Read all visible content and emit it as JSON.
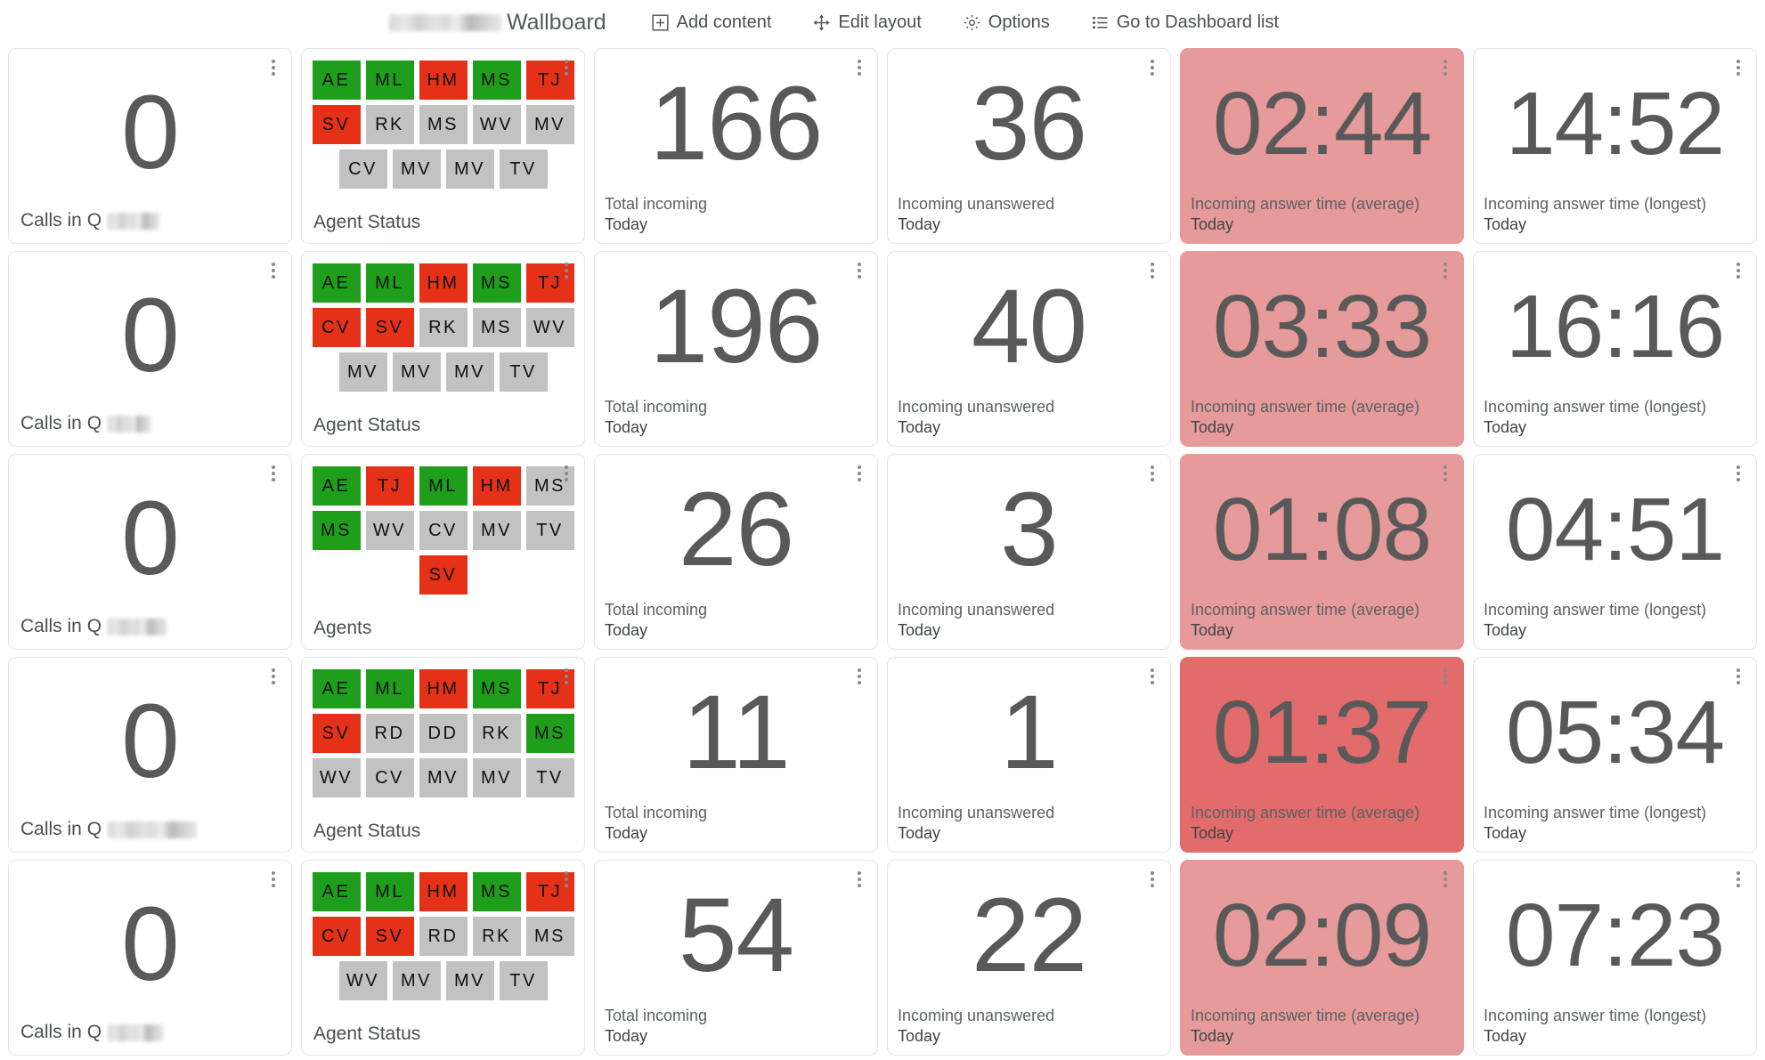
{
  "toolbar": {
    "title_suffix": "Wallboard",
    "title_redacted": true,
    "items": [
      {
        "label": "Add content",
        "icon": "plus-box-icon"
      },
      {
        "label": "Edit layout",
        "icon": "move-arrows-icon"
      },
      {
        "label": "Options",
        "icon": "gear-icon"
      },
      {
        "label": "Go to Dashboard list",
        "icon": "list-icon"
      }
    ]
  },
  "queue_label_prefix": "Calls in Q",
  "colors": {
    "agent_available": "#1f9e1b",
    "agent_busy": "#e43118",
    "agent_offline": "#c2c2c2",
    "tint_light": "#e79a9a",
    "tint_strong": "#e26b6b",
    "value_text": "#595959"
  },
  "rows": [
    {
      "calls_in_queue": {
        "value": "0",
        "label": "Calls in Q",
        "redacted_width": 58
      },
      "agents": {
        "label": "Agent Status",
        "rows": [
          [
            {
              "t": "AE",
              "s": "g"
            },
            {
              "t": "ML",
              "s": "g"
            },
            {
              "t": "HM",
              "s": "r"
            },
            {
              "t": "MS",
              "s": "g"
            },
            {
              "t": "TJ",
              "s": "r"
            }
          ],
          [
            {
              "t": "SV",
              "s": "r"
            },
            {
              "t": "RK",
              "s": "a"
            },
            {
              "t": "MS",
              "s": "a"
            },
            {
              "t": "WV",
              "s": "a"
            },
            {
              "t": "MV",
              "s": "a"
            }
          ],
          [
            {
              "t": "CV",
              "s": "a"
            },
            {
              "t": "MV",
              "s": "a"
            },
            {
              "t": "MV",
              "s": "a"
            },
            {
              "t": "TV",
              "s": "a"
            }
          ]
        ]
      },
      "total_incoming": {
        "value": "166",
        "label1": "Total incoming",
        "label2": "Today"
      },
      "unanswered": {
        "value": "36",
        "label1": "Incoming unanswered",
        "label2": "Today"
      },
      "answer_avg": {
        "value": "02:44",
        "label1": "Incoming answer time (average)",
        "label2": "Today",
        "tint": "light"
      },
      "answer_longest": {
        "value": "14:52",
        "label1": "Incoming answer time (longest)",
        "label2": "Today",
        "tint": "none"
      }
    },
    {
      "calls_in_queue": {
        "value": "0",
        "label": "Calls in Q",
        "redacted_width": 48
      },
      "agents": {
        "label": "Agent Status",
        "rows": [
          [
            {
              "t": "AE",
              "s": "g"
            },
            {
              "t": "ML",
              "s": "g"
            },
            {
              "t": "HM",
              "s": "r"
            },
            {
              "t": "MS",
              "s": "g"
            },
            {
              "t": "TJ",
              "s": "r"
            }
          ],
          [
            {
              "t": "CV",
              "s": "r"
            },
            {
              "t": "SV",
              "s": "r"
            },
            {
              "t": "RK",
              "s": "a"
            },
            {
              "t": "MS",
              "s": "a"
            },
            {
              "t": "WV",
              "s": "a"
            }
          ],
          [
            {
              "t": "MV",
              "s": "a"
            },
            {
              "t": "MV",
              "s": "a"
            },
            {
              "t": "MV",
              "s": "a"
            },
            {
              "t": "TV",
              "s": "a"
            }
          ]
        ]
      },
      "total_incoming": {
        "value": "196",
        "label1": "Total incoming",
        "label2": "Today"
      },
      "unanswered": {
        "value": "40",
        "label1": "Incoming unanswered",
        "label2": "Today"
      },
      "answer_avg": {
        "value": "03:33",
        "label1": "Incoming answer time (average)",
        "label2": "Today",
        "tint": "light"
      },
      "answer_longest": {
        "value": "16:16",
        "label1": "Incoming answer time (longest)",
        "label2": "Today",
        "tint": "none"
      }
    },
    {
      "calls_in_queue": {
        "value": "0",
        "label": "Calls in Q",
        "redacted_width": 66
      },
      "agents": {
        "label": "Agents",
        "rows": [
          [
            {
              "t": "AE",
              "s": "g"
            },
            {
              "t": "TJ",
              "s": "r"
            },
            {
              "t": "ML",
              "s": "g"
            },
            {
              "t": "HM",
              "s": "r"
            },
            {
              "t": "MS",
              "s": "a"
            }
          ],
          [
            {
              "t": "MS",
              "s": "g"
            },
            {
              "t": "WV",
              "s": "a"
            },
            {
              "t": "CV",
              "s": "a"
            },
            {
              "t": "MV",
              "s": "a"
            },
            {
              "t": "TV",
              "s": "a"
            }
          ],
          [
            {
              "t": "SV",
              "s": "r"
            }
          ]
        ]
      },
      "total_incoming": {
        "value": "26",
        "label1": "Total incoming",
        "label2": "Today"
      },
      "unanswered": {
        "value": "3",
        "label1": "Incoming unanswered",
        "label2": "Today"
      },
      "answer_avg": {
        "value": "01:08",
        "label1": "Incoming answer time (average)",
        "label2": "Today",
        "tint": "light"
      },
      "answer_longest": {
        "value": "04:51",
        "label1": "Incoming answer time (longest)",
        "label2": "Today",
        "tint": "none"
      }
    },
    {
      "calls_in_queue": {
        "value": "0",
        "label": "Calls in Q",
        "redacted_width": 100
      },
      "agents": {
        "label": "Agent Status",
        "rows": [
          [
            {
              "t": "AE",
              "s": "g"
            },
            {
              "t": "ML",
              "s": "g"
            },
            {
              "t": "HM",
              "s": "r"
            },
            {
              "t": "MS",
              "s": "g"
            },
            {
              "t": "TJ",
              "s": "r"
            }
          ],
          [
            {
              "t": "SV",
              "s": "r"
            },
            {
              "t": "RD",
              "s": "a"
            },
            {
              "t": "DD",
              "s": "a"
            },
            {
              "t": "RK",
              "s": "a"
            },
            {
              "t": "MS",
              "s": "g"
            }
          ],
          [
            {
              "t": "WV",
              "s": "a"
            },
            {
              "t": "CV",
              "s": "a"
            },
            {
              "t": "MV",
              "s": "a"
            },
            {
              "t": "MV",
              "s": "a"
            },
            {
              "t": "TV",
              "s": "a"
            }
          ]
        ]
      },
      "total_incoming": {
        "value": "11",
        "label1": "Total incoming",
        "label2": "Today"
      },
      "unanswered": {
        "value": "1",
        "label1": "Incoming unanswered",
        "label2": "Today"
      },
      "answer_avg": {
        "value": "01:37",
        "label1": "Incoming answer time (average)",
        "label2": "Today",
        "tint": "strong"
      },
      "answer_longest": {
        "value": "05:34",
        "label1": "Incoming answer time (longest)",
        "label2": "Today",
        "tint": "none"
      }
    },
    {
      "calls_in_queue": {
        "value": "0",
        "label": "Calls in Q",
        "redacted_width": 62
      },
      "agents": {
        "label": "Agent Status",
        "rows": [
          [
            {
              "t": "AE",
              "s": "g"
            },
            {
              "t": "ML",
              "s": "g"
            },
            {
              "t": "HM",
              "s": "r"
            },
            {
              "t": "MS",
              "s": "g"
            },
            {
              "t": "TJ",
              "s": "r"
            }
          ],
          [
            {
              "t": "CV",
              "s": "r"
            },
            {
              "t": "SV",
              "s": "r"
            },
            {
              "t": "RD",
              "s": "a"
            },
            {
              "t": "RK",
              "s": "a"
            },
            {
              "t": "MS",
              "s": "a"
            }
          ],
          [
            {
              "t": "WV",
              "s": "a"
            },
            {
              "t": "MV",
              "s": "a"
            },
            {
              "t": "MV",
              "s": "a"
            },
            {
              "t": "TV",
              "s": "a"
            }
          ]
        ]
      },
      "total_incoming": {
        "value": "54",
        "label1": "Total incoming",
        "label2": "Today"
      },
      "unanswered": {
        "value": "22",
        "label1": "Incoming unanswered",
        "label2": "Today"
      },
      "answer_avg": {
        "value": "02:09",
        "label1": "Incoming answer time (average)",
        "label2": "Today",
        "tint": "light"
      },
      "answer_longest": {
        "value": "07:23",
        "label1": "Incoming answer time (longest)",
        "label2": "Today",
        "tint": "none"
      }
    }
  ]
}
